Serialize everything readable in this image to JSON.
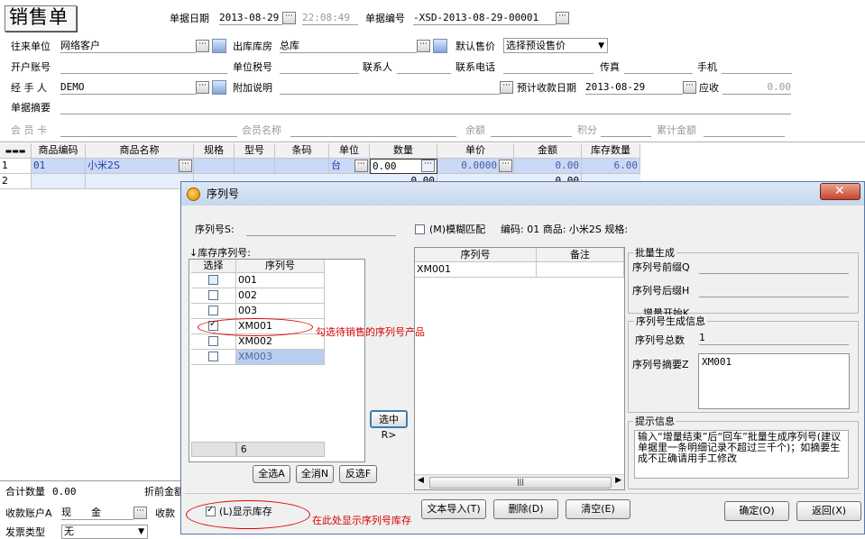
{
  "title": "销售单",
  "header": {
    "date_label": "单据日期",
    "date": "2013-08-29",
    "time": "22:08:49",
    "no_label": "单据编号",
    "no": "-XSD-2013-08-29-00001"
  },
  "form": {
    "customer_label": "往来单位",
    "customer": "网络客户",
    "warehouse_label": "出库库房",
    "warehouse": "总库",
    "price_label": "默认售价",
    "price": "选择预设售价",
    "account_label": "开户账号",
    "tax_label": "单位税号",
    "contact_label": "联系人",
    "phone_label": "联系电话",
    "fax_label": "传真",
    "mobile_label": "手机",
    "handler_label": "经 手 人",
    "handler": "DEMO",
    "note_label": "附加说明",
    "due_label": "预计收款日期",
    "due": "2013-08-29",
    "receivable_label": "应收",
    "receivable": "0.00",
    "summary_label": "单据摘要",
    "member_label": "会 员 卡",
    "member_name_label": "会员名称",
    "balance_label": "余额",
    "points_label": "积分",
    "total_label": "累计金额"
  },
  "grid": {
    "columns": [
      "商品编码",
      "商品名称",
      "规格",
      "型号",
      "条码",
      "单位",
      "数量",
      "单价",
      "金额",
      "库存数量"
    ],
    "row1": {
      "idx": "1",
      "code": "01",
      "name": "小米2S",
      "unit": "台",
      "qty": "0.00",
      "price": "0.0000",
      "amount": "0.00",
      "stock": "6.00"
    },
    "row2": {
      "idx": "2",
      "amount": "0.00",
      "qty": "0.00"
    }
  },
  "footer": {
    "qty_total_label": "合计数量",
    "qty_total": "0.00",
    "discount_label": "折前金额",
    "account_label": "收款账户A",
    "account": "现　　金",
    "receipt_label": "收款",
    "invoice_label": "发票类型",
    "invoice": "无"
  },
  "dialog": {
    "title": "序列号",
    "serial_label": "序列号S:",
    "fuzzy_label": "(M)模糊匹配",
    "info": "编码: 01 商品: 小米2S 规格:",
    "stock_serial_label": "↓库存序列号:",
    "left_cols": [
      "选择",
      "序列号"
    ],
    "left_rows": [
      {
        "sn": "001",
        "checked": false
      },
      {
        "sn": "002",
        "checked": false
      },
      {
        "sn": "003",
        "checked": false
      },
      {
        "sn": "XM001",
        "checked": true
      },
      {
        "sn": "XM002",
        "checked": false
      },
      {
        "sn": "XM003",
        "checked": false
      }
    ],
    "count": "6",
    "select_btn": "选中R>",
    "select_all": "全选A",
    "deselect_all": "全消N",
    "invert": "反选F",
    "mid_cols": [
      "序列号",
      "备注"
    ],
    "mid_rows": [
      "XM001"
    ],
    "batch_title": "批量生成",
    "prefix_label": "序列号前缀Q",
    "suffix_label": "序列号后缀H",
    "start_label": "增量开始K",
    "gen_title": "序列号生成信息",
    "total_label": "序列号总数",
    "total_value": "1",
    "summary_label": "序列号摘要Z",
    "summary_value": "XM001",
    "tip_title": "提示信息",
    "tip_text": "输入“增量结束”后“回车”批量生成序列号(建议单据里一条明细记录不超过三千个)；如摘要生成不正确请用手工修改",
    "show_stock": "(L)显示库存",
    "import_btn": "文本导入(T)",
    "delete_btn": "删除(D)",
    "clear_btn": "清空(E)",
    "ok_btn": "确定(O)",
    "back_btn": "返回(X)"
  },
  "annotations": {
    "check_note": "勾选待销售的序列号产品",
    "stock_note": "在此处显示序列号库存"
  }
}
